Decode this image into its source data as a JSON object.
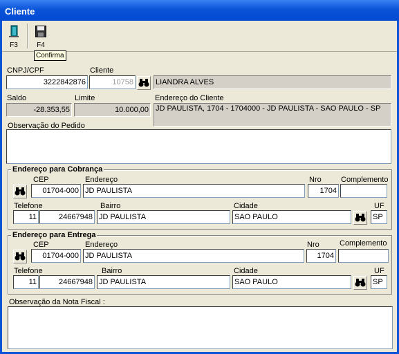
{
  "window": {
    "title": "Cliente"
  },
  "toolbar": {
    "exit_key": "F3",
    "save_key": "F4",
    "tooltip": "Confirma"
  },
  "customer": {
    "cnpj_label": "CNPJ/CPF",
    "cnpj": "3222842876",
    "cliente_label": "Cliente",
    "cliente_code": "10758",
    "cliente_name": "LIANDRA ALVES",
    "saldo_label": "Saldo",
    "saldo": "-28.353,55",
    "limite_label": "Limite",
    "limite": "10.000,00",
    "endereco_label": "Endereço do Cliente",
    "endereco": "JD PAULISTA, 1704  -  1704000  -  JD PAULISTA  -  SAO PAULO  -  SP",
    "obs_label": "Observação do Pedido",
    "obs": ""
  },
  "cobranca": {
    "title": "Endereço para Cobrança",
    "cep_label": "CEP",
    "cep": "01704-000",
    "endereco_label": "Endereço",
    "endereco": "JD PAULISTA",
    "nro_label": "Nro",
    "nro": "1704",
    "complemento_label": "Complemento",
    "complemento": "",
    "telefone_label": "Telefone",
    "ddd": "11",
    "telefone": "24667948",
    "bairro_label": "Bairro",
    "bairro": "JD PAULISTA",
    "cidade_label": "Cidade",
    "cidade": "SAO PAULO",
    "uf_label": "UF",
    "uf": "SP"
  },
  "entrega": {
    "title": "Endereço para Entrega",
    "cep_label": "CEP",
    "cep": "01704-000",
    "endereco_label": "Endereço",
    "endereco": "JD PAULISTA",
    "nro_label": "Nro",
    "nro": "1704",
    "complemento_label": "Complemento",
    "complemento": "",
    "telefone_label": "Telefone",
    "ddd": "11",
    "telefone": "24667948",
    "bairro_label": "Bairro",
    "bairro": "JD PAULISTA",
    "cidade_label": "Cidade",
    "cidade": "SAO PAULO",
    "uf_label": "UF",
    "uf": "SP"
  },
  "nota": {
    "obs_label": "Observação da Nota Fiscal :",
    "obs": ""
  }
}
